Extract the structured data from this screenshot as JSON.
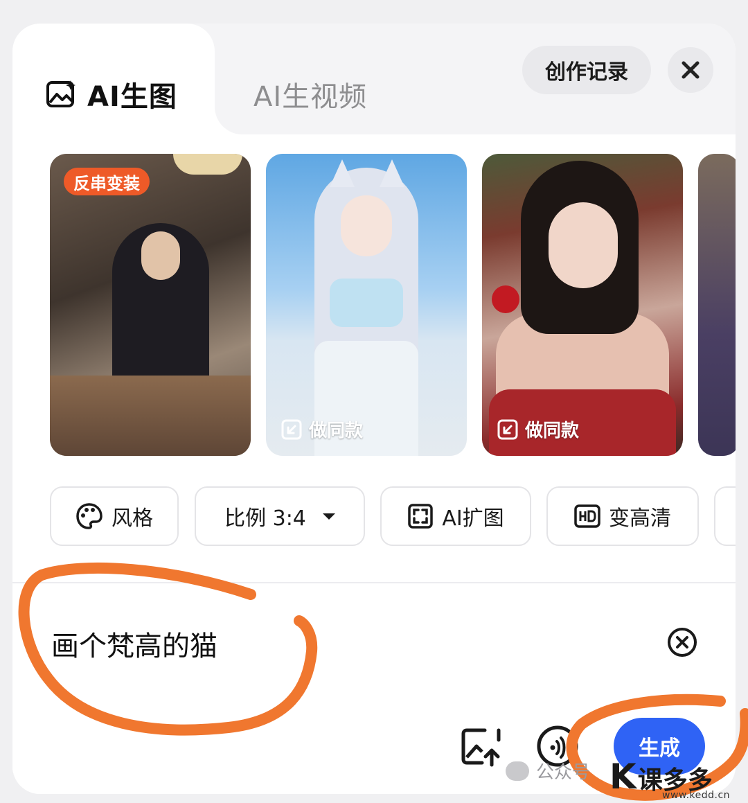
{
  "tabs": {
    "image_label": "AI生图",
    "video_label": "AI生视频"
  },
  "header": {
    "history_label": "创作记录",
    "close_icon": "close-icon"
  },
  "gallery": {
    "cards": [
      {
        "badge": "反串变装",
        "action": ""
      },
      {
        "badge": "",
        "action": "做同款"
      },
      {
        "badge": "",
        "action": "做同款"
      }
    ]
  },
  "tools": {
    "style_label": "风格",
    "ratio_label": "比例 3:4",
    "expand_label": "AI扩图",
    "hd_label": "变高清"
  },
  "prompt": {
    "text": "画个梵高的猫",
    "generate_label": "生成"
  },
  "watermark": {
    "account": "公众号",
    "brand_name": "课多多",
    "brand_url": "www.kedd.cn"
  },
  "colors": {
    "accent": "#2f63f5",
    "badge": "#ee5a28",
    "annotation": "#f0772f"
  }
}
